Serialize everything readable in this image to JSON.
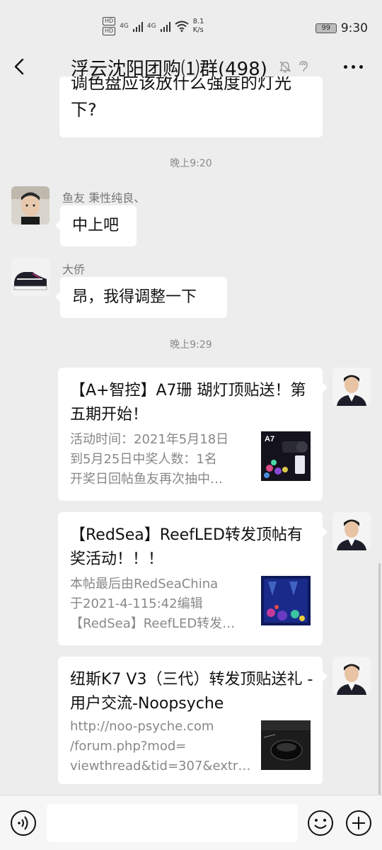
{
  "status_bar": {
    "hd1": "HD",
    "hd2": "HD",
    "net1": "4G",
    "net2": "4G",
    "speed_value": "8.1",
    "speed_unit": "K/s",
    "battery": "99",
    "time": "9:30"
  },
  "header": {
    "title": "浮云沈阳团购⑴群(498)",
    "back_icon": "chevron-left-icon",
    "more_icon": "more-icon"
  },
  "messages": {
    "partial_line1": "调色盘应该放什么强度的灯光",
    "partial_line2": "下?",
    "time1": "晚上9:20",
    "msg1": {
      "sender": "鱼友 秉性纯良、",
      "text": "中上吧"
    },
    "msg2": {
      "sender": "大侨",
      "text": "昂，我得调整一下"
    },
    "time2": "晚上9:29"
  },
  "cards": [
    {
      "title": "【A+智控】A7珊 瑚灯顶贴送！第五期开始！",
      "desc": [
        "活动时间：2021年5月18日",
        "到5月25日中奖人数：1名",
        "开奖日回帖鱼友再次抽中…"
      ],
      "thumb_label": "A7"
    },
    {
      "title": "【RedSea】ReefLED转发顶帖有奖活动！！！",
      "desc": [
        "本帖最后由RedSeaChina",
        "于2021-4-115:42编辑",
        "【RedSea】ReefLED转发…"
      ]
    },
    {
      "title": "纽斯K7 V3（三代）转发顶贴送礼 - 用户交流-Noopsyche",
      "desc": [
        "http://noo-psyche.com",
        "/forum.php?mod=",
        "viewthread&tid=307&extr…"
      ]
    }
  ],
  "input_bar": {
    "voice_icon": "voice-icon",
    "emoji_icon": "emoji-icon",
    "plus_icon": "plus-icon",
    "input_value": ""
  }
}
